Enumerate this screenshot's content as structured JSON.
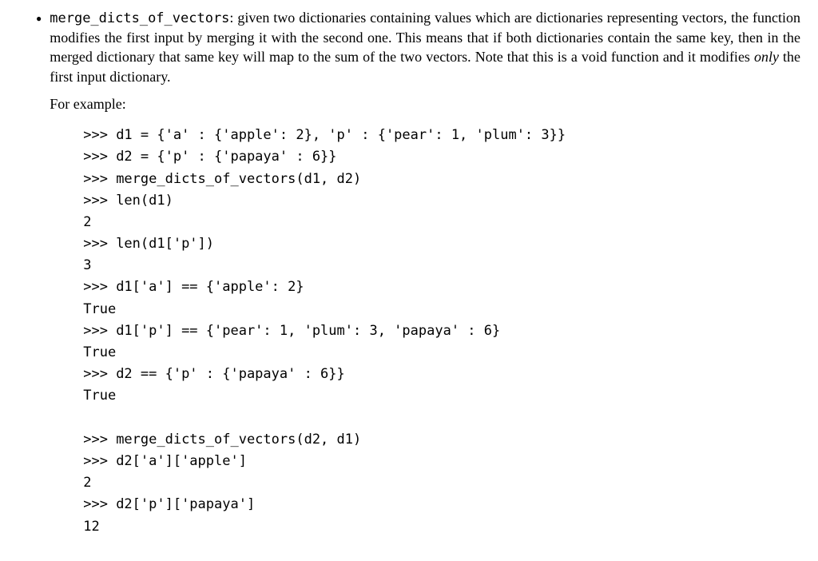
{
  "item": {
    "function_name": "merge_dicts_of_vectors",
    "desc_segments": {
      "s1": ": given two dictionaries containing values which are dictionaries representing vectors, the function modifies the first input by merging it with the second one. This means that if both dictionaries contain the same key, then in the merged dictionary that same key will map to the sum of the two vectors. Note that this is a void function and it modifies ",
      "only_word": "only",
      "s2": " the first input dictionary."
    },
    "example_label": "For example:",
    "code": ">>> d1 = {'a' : {'apple': 2}, 'p' : {'pear': 1, 'plum': 3}}\n>>> d2 = {'p' : {'papaya' : 6}}\n>>> merge_dicts_of_vectors(d1, d2)\n>>> len(d1)\n2\n>>> len(d1['p'])\n3\n>>> d1['a'] == {'apple': 2}\nTrue\n>>> d1['p'] == {'pear': 1, 'plum': 3, 'papaya' : 6}\nTrue\n>>> d2 == {'p' : {'papaya' : 6}}\nTrue\n\n>>> merge_dicts_of_vectors(d2, d1)\n>>> d2['a']['apple']\n2\n>>> d2['p']['papaya']\n12"
  }
}
